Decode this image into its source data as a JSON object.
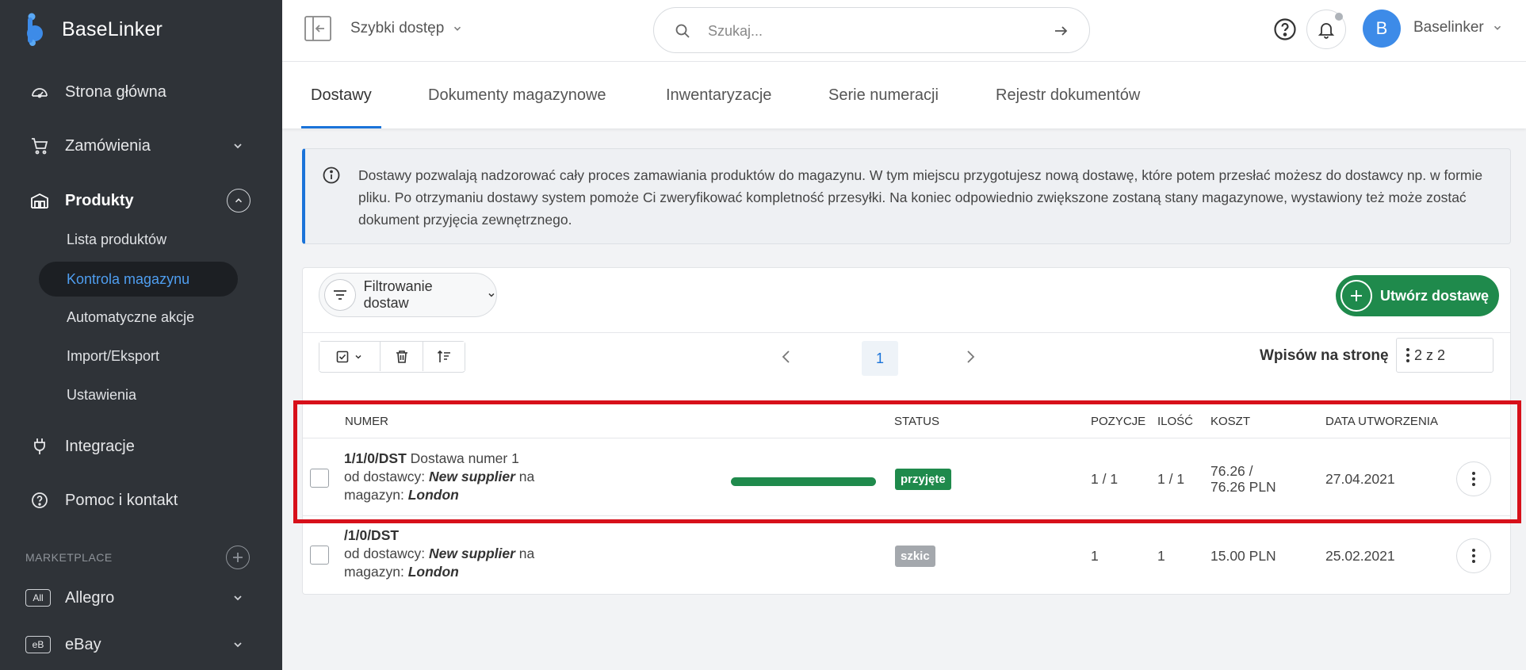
{
  "brand": {
    "name": "BaseLinker"
  },
  "sidebar": {
    "items": [
      {
        "label": "Strona główna",
        "icon": "dashboard-icon"
      },
      {
        "label": "Zamówienia",
        "icon": "cart-icon"
      },
      {
        "label": "Produkty",
        "icon": "warehouse-icon"
      },
      {
        "label": "Integracje",
        "icon": "plug-icon"
      },
      {
        "label": "Pomoc i kontakt",
        "icon": "help-icon"
      }
    ],
    "subitems": [
      {
        "label": "Lista produktów"
      },
      {
        "label": "Kontrola magazynu"
      },
      {
        "label": "Automatyczne akcje"
      },
      {
        "label": "Import/Eksport"
      },
      {
        "label": "Ustawienia"
      }
    ],
    "marketplace_header": "MARKETPLACE",
    "marketplace": [
      {
        "badge": "All",
        "label": "Allegro"
      },
      {
        "badge": "eB",
        "label": "eBay"
      }
    ]
  },
  "topbar": {
    "quick_access": "Szybki dostęp",
    "search_placeholder": "Szukaj...",
    "avatar_letter": "B",
    "user_name": "Baselinker"
  },
  "tabs": [
    {
      "label": "Dostawy"
    },
    {
      "label": "Dokumenty magazynowe"
    },
    {
      "label": "Inwentaryzacje"
    },
    {
      "label": "Serie numeracji"
    },
    {
      "label": "Rejestr dokumentów"
    }
  ],
  "info_text": "Dostawy pozwalają nadzorować cały proces zamawiania produktów do magazynu. W tym miejscu przygotujesz nową dostawę, które potem przesłać możesz do dostawcy np. w formie pliku. Po otrzymaniu dostawy system pomoże Ci zweryfikować kompletność przesyłki. Na koniec odpowiednio zwiększone zostaną stany magazynowe, wystawiony też może zostać dokument przyjęcia zewnętrznego.",
  "card": {
    "filter_label": "Filtrowanie dostaw",
    "create_label": "Utwórz dostawę",
    "page": "1",
    "per_page_label": "Wpisów na stronę",
    "per_page_value": "2 z 2"
  },
  "table": {
    "columns": [
      "NUMER",
      "STATUS",
      "POZYCJE",
      "ILOŚĆ",
      "KOSZT",
      "DATA UTWORZENIA"
    ],
    "rows": [
      {
        "number": "1/1/0/DST",
        "name": " Dostawa numer 1",
        "supplier_prefix": "od dostawcy: ",
        "supplier": "New supplier",
        "supplier_suffix": " na",
        "warehouse_prefix": "magazyn: ",
        "warehouse": "London",
        "progress": 1.0,
        "status": "przyjęte",
        "status_color": "#1f8a4c",
        "positions": "1 / 1",
        "quantity": "1 / 1",
        "cost_line1": "76.26 /",
        "cost_line2": "76.26 PLN",
        "date": "27.04.2021"
      },
      {
        "number": "/1/0/DST",
        "name": "",
        "supplier_prefix": "od dostawcy: ",
        "supplier": "New supplier",
        "supplier_suffix": " na",
        "warehouse_prefix": "magazyn: ",
        "warehouse": "London",
        "progress": 0,
        "status": "szkic",
        "status_color": "#a4a8ad",
        "positions": "1",
        "quantity": "1",
        "cost_line1": "15.00 PLN",
        "cost_line2": "",
        "date": "25.02.2021"
      }
    ]
  },
  "colors": {
    "accent": "#1a73d9",
    "success": "#1f8a4c",
    "highlight": "#d7101a",
    "sidebar_bg": "#2f3338"
  }
}
